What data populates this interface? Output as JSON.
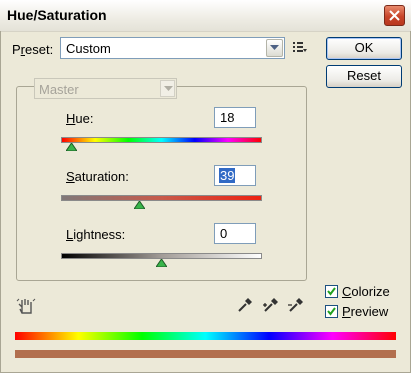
{
  "window": {
    "title": "Hue/Saturation"
  },
  "preset": {
    "label": "Preset:",
    "value": "Custom"
  },
  "buttons": {
    "ok": "OK",
    "reset": "Reset"
  },
  "edit": {
    "value": "Master"
  },
  "sliders": {
    "hue": {
      "label": "Hue:",
      "value": "18",
      "level": 0.05
    },
    "saturation": {
      "label": "Saturation:",
      "value": "39",
      "level": 0.39
    },
    "lightness": {
      "label": "Lightness:",
      "value": "0",
      "level": 0.5
    }
  },
  "options": {
    "colorize": "Colorize",
    "preview": "Preview",
    "colorize_checked": true,
    "preview_checked": true
  },
  "colors": {
    "result_bar": "#b26f4e"
  }
}
